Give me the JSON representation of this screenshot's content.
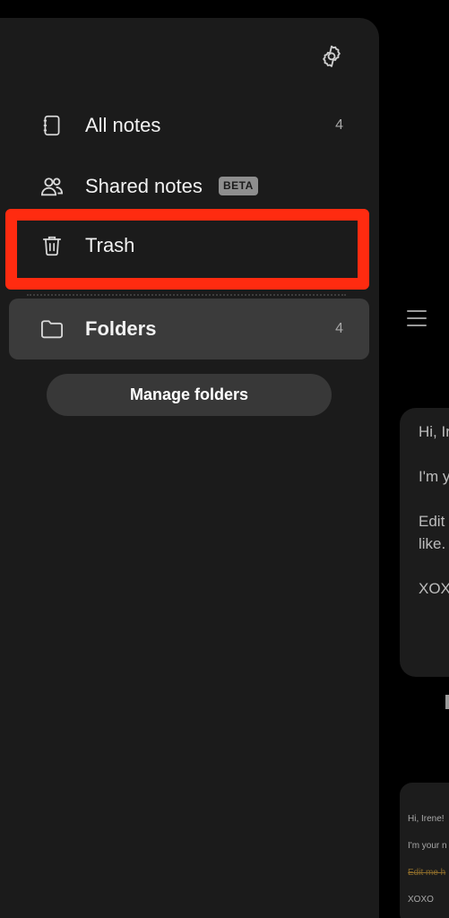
{
  "drawer": {
    "items": [
      {
        "label": "All notes",
        "count": "4",
        "icon": "notebook-icon"
      },
      {
        "label": "Shared notes",
        "badge": "BETA",
        "icon": "people-icon"
      },
      {
        "label": "Trash",
        "icon": "trash-icon"
      }
    ],
    "folders": {
      "label": "Folders",
      "count": "4",
      "icon": "folder-icon"
    },
    "manage_folders_label": "Manage folders"
  },
  "background": {
    "card1": [
      "Hi, Ir",
      "I'm y",
      "Edit",
      "like.",
      "XOX"
    ],
    "card2": [
      "Hi, Irene!",
      "I'm your n",
      "Edit me h",
      "XOXO"
    ]
  },
  "colors": {
    "drawer_bg": "#1b1b1b",
    "highlight": "#ff2b10",
    "folders_bg": "#3b3b3b",
    "button_bg": "#383838"
  }
}
